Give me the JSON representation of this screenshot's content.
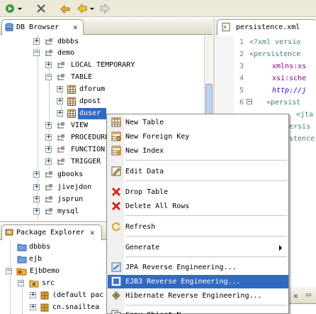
{
  "colors": {
    "selection": "#316ac5",
    "keyword": "#3f7f7f",
    "attribute": "#7f007f",
    "value": "#2a00ff"
  },
  "db_browser": {
    "tab_label": "DB Browser",
    "tree": [
      "dbbbs",
      "demo",
      "LOCAL TEMPORARY",
      "TABLE",
      "dforum",
      "dpost",
      "duser",
      "VIEW",
      "PROCEDURE",
      "FUNCTION",
      "TRIGGER",
      "gbooks",
      "jivejdon",
      "jsprun",
      "mysql"
    ]
  },
  "package_explorer": {
    "tab_label": "Package Explorer",
    "tree": [
      "dbbbs",
      "ejb",
      "EjbDemo",
      "src",
      "(default pac",
      "cn.snailtea"
    ]
  },
  "editor": {
    "tab_label": "persistence.xml",
    "line_numbers": [
      "1",
      "2",
      "3",
      "4",
      "5",
      "6"
    ],
    "lines": [
      "<?xml versio",
      "<persistence",
      "xmlns:xs",
      "xsi:sche",
      "http://j",
      "<persist",
      "<jta",
      "ersis",
      "stence"
    ]
  },
  "context_menu": {
    "items": [
      {
        "label": "New Table",
        "icon": "new-table-icon"
      },
      {
        "label": "New Foreign Key",
        "icon": "foreign-key-icon"
      },
      {
        "label": "New Index",
        "icon": "index-icon"
      },
      {
        "label": "Edit Data",
        "icon": "edit-data-icon"
      },
      {
        "label": "Drop Table",
        "icon": "drop-icon"
      },
      {
        "label": "Delete All Rows",
        "icon": "delete-rows-icon"
      },
      {
        "label": "Refresh",
        "icon": "refresh-icon"
      },
      {
        "label": "Generate",
        "icon": ""
      },
      {
        "label": "JPA Reverse Engineering...",
        "icon": "jpa-icon"
      },
      {
        "label": "EJB3 Reverse Engineering...",
        "icon": "ejb3-icon"
      },
      {
        "label": "Hibernate Reverse Engineering...",
        "icon": "hibernate-icon"
      },
      {
        "label": "Copy Object N...",
        "icon": "copy-icon"
      }
    ]
  }
}
